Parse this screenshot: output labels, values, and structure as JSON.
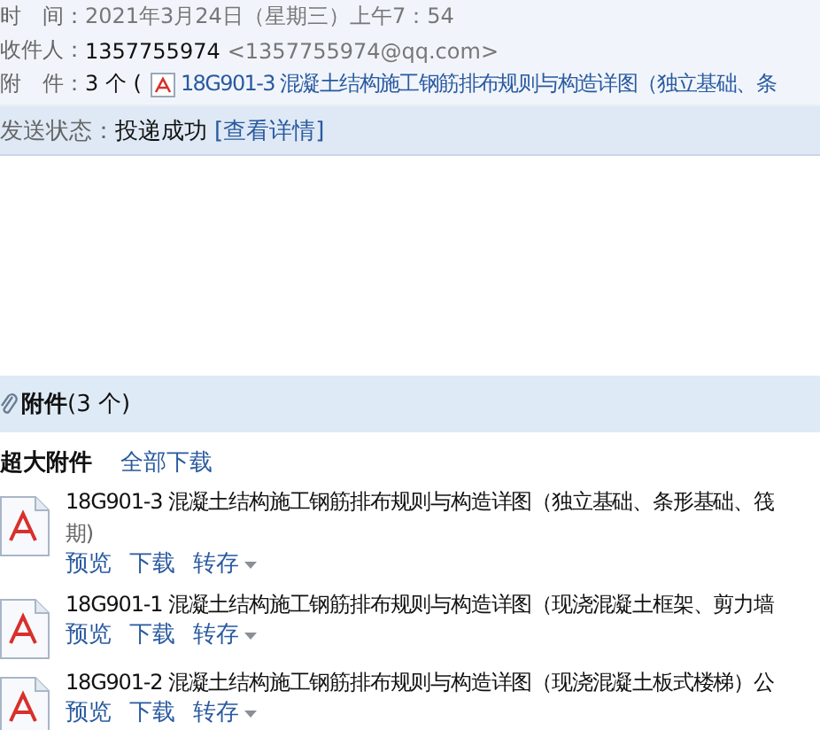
{
  "header": {
    "fields": [
      {
        "label": "时　间：",
        "kind": "date",
        "value": "2021年3月24日（星期三）上午7：54"
      },
      {
        "label": "收件人：",
        "kind": "recipient",
        "value": "1357755974",
        "detail": "<1357755974@qq.com>"
      },
      {
        "label": "附　件：",
        "kind": "attachment",
        "value": "3 个 (",
        "detail": "18G901-3 混凝土结构施工钢筋排布规则与构造详图（独立基础、条"
      }
    ]
  },
  "status": {
    "label": "发送状态：",
    "value": "投递成功",
    "link": "[查看详情]"
  },
  "attachments": {
    "title": "附件",
    "count": "(3 个)",
    "group_label": "超大附件",
    "download_all": "全部下载",
    "items": [
      {
        "title_lines": [
          "18G901-3 混凝土结构施工钢筋排布规则与构造详图（独立基础、条形基础、筏",
          "期)"
        ],
        "actions": [
          "预览",
          "下载",
          "转存"
        ]
      },
      {
        "title_lines": [
          "18G901-1 混凝土结构施工钢筋排布规则与构造详图（现浇混凝土框架、剪力墙"
        ],
        "actions": [
          "预览",
          "下载",
          "转存"
        ]
      },
      {
        "title_lines": [
          "18G901-2 混凝土结构施工钢筋排布规则与构造详图（现浇混凝土板式楼梯）公"
        ],
        "actions": [
          "预览",
          "下载",
          "转存"
        ]
      }
    ]
  }
}
